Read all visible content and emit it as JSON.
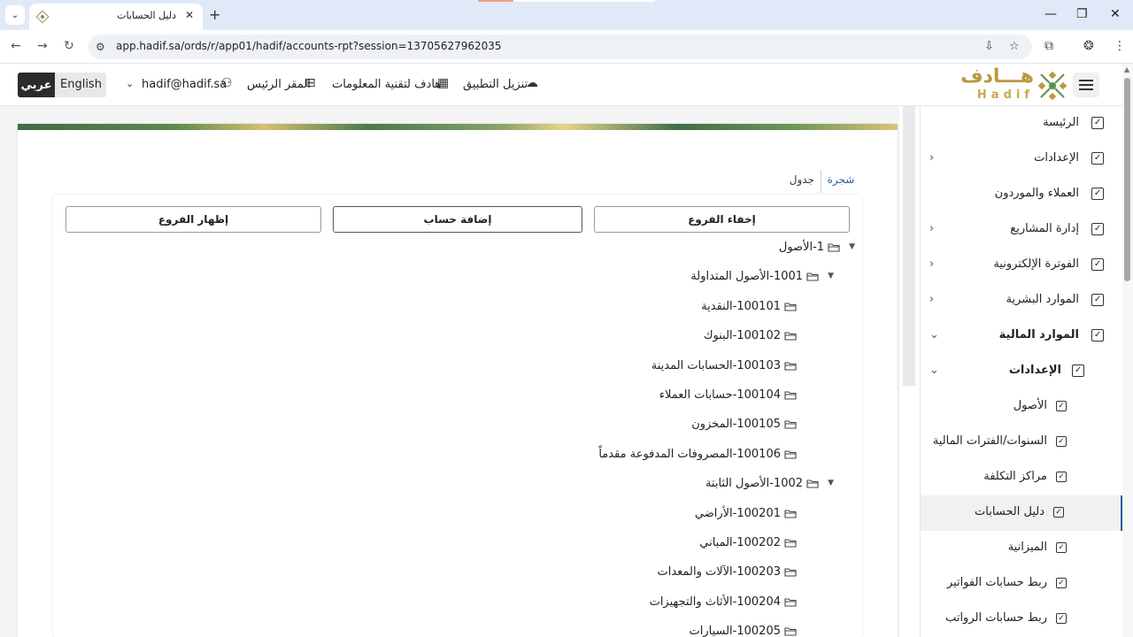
{
  "browser": {
    "tab_title": "دليل الحسابات",
    "url": "app.hadif.sa/ords/r/app01/hadif/accounts-rpt?session=13705627962035"
  },
  "header": {
    "logo_ar": "هـــادف",
    "logo_en": "Hadif",
    "download_app": "تنزيل التطبيق",
    "company": "هادف لتقنية المعلومات",
    "headquarters": "المقر الرئيس",
    "user": "hadif@hadif.sa",
    "lang_ar": "عربي",
    "lang_en": "English"
  },
  "sidebar": {
    "items": [
      {
        "label": "الرئيسة",
        "level": 0,
        "arrow": ""
      },
      {
        "label": "الإعدادات",
        "level": 0,
        "arrow": "›"
      },
      {
        "label": "العملاء والموردون",
        "level": 0,
        "arrow": ""
      },
      {
        "label": "إدارة المشاريع",
        "level": 0,
        "arrow": "›"
      },
      {
        "label": "الفوترة الإلكترونية",
        "level": 0,
        "arrow": "›"
      },
      {
        "label": "الموارد البشرية",
        "level": 0,
        "arrow": "›"
      },
      {
        "label": "الموارد المالية",
        "level": 0,
        "arrow": "⌄"
      },
      {
        "label": "الإعدادات",
        "level": 1,
        "arrow": "⌄"
      },
      {
        "label": "الأصول",
        "level": 2,
        "arrow": ""
      },
      {
        "label": "السنوات/الفترات المالية",
        "level": 2,
        "arrow": ""
      },
      {
        "label": "مراكز التكلفة",
        "level": 2,
        "arrow": ""
      },
      {
        "label": "دليل الحسابات",
        "level": 2,
        "arrow": "",
        "active": true
      },
      {
        "label": "الميزانية",
        "level": 2,
        "arrow": ""
      },
      {
        "label": "ربط حسابات الفواتير",
        "level": 2,
        "arrow": ""
      },
      {
        "label": "ربط حسابات الرواتب",
        "level": 2,
        "arrow": ""
      }
    ]
  },
  "tabs": {
    "tree": "شجرة",
    "table": "جدول"
  },
  "buttons": {
    "hide_branches": "إخفاء الفروع",
    "add_account": "إضافة حساب",
    "show_branches": "إظهار الفروع"
  },
  "tree": [
    {
      "label": "1-الأصول",
      "level": 0,
      "expanded": true
    },
    {
      "label": "1001-الأصول المتداولة",
      "level": 1,
      "expanded": true
    },
    {
      "label": "100101-النقدية",
      "level": 2
    },
    {
      "label": "100102-البنوك",
      "level": 2
    },
    {
      "label": "100103-الحسابات المدينة",
      "level": 2
    },
    {
      "label": "100104-حسابات العملاء",
      "level": 2
    },
    {
      "label": "100105-المخزون",
      "level": 2
    },
    {
      "label": "100106-المصروفات المدفوعة مقدماً",
      "level": 2
    },
    {
      "label": "1002-الأصول الثابتة",
      "level": 1,
      "expanded": true
    },
    {
      "label": "100201-الأراضي",
      "level": 2
    },
    {
      "label": "100202-المباني",
      "level": 2
    },
    {
      "label": "100203-الآلات والمعدات",
      "level": 2
    },
    {
      "label": "100204-الأثاث والتجهيزات",
      "level": 2
    },
    {
      "label": "100205-السيارات",
      "level": 2
    }
  ]
}
